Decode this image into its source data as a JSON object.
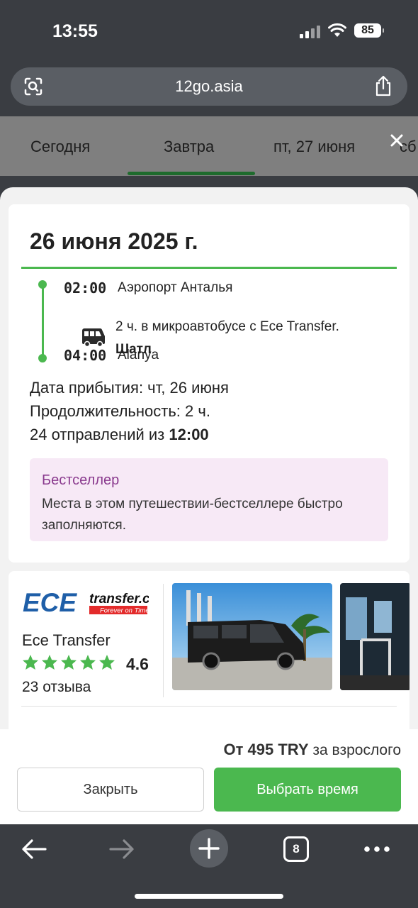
{
  "status_bar": {
    "time": "13:55",
    "battery": "85"
  },
  "browser": {
    "url": "12go.asia",
    "tab_count": "8"
  },
  "date_tabs": [
    {
      "label": "Сегодня"
    },
    {
      "label": "Завтра"
    },
    {
      "label": "пт, 27 июня"
    },
    {
      "label": "сб"
    }
  ],
  "trip": {
    "date_title": "26 июня 2025 г.",
    "departure": {
      "time": "02:00",
      "place": "Аэропорт Анталья"
    },
    "segment": {
      "description": "2 ч. в микроавтобусе с Ece Transfer.",
      "type": "Шатл"
    },
    "arrival": {
      "time": "04:00",
      "place": "Alanya"
    },
    "arrival_date": "Дата прибытия: чт, 26 июня",
    "duration": "Продолжительность: 2 ч.",
    "departures_prefix": "24 отправлений из ",
    "departures_time": "12:00",
    "bestseller_title": "Бестселлер",
    "bestseller_text": "Места в этом путешествии-бестселлере быстро заполняются."
  },
  "operator": {
    "logo_text": "ECE",
    "logo_sub": "transfer.com",
    "logo_tagline": "Forever on Time",
    "name": "Ece Transfer",
    "rating": "4.6",
    "stars": 5,
    "reviews": "23 отзыва"
  },
  "booking": {
    "price_prefix": "От ",
    "price": "495 TRY",
    "price_suffix": " за взрослого",
    "close_label": "Закрыть",
    "select_label": "Выбрать время"
  },
  "colors": {
    "accent_green": "#4bb84f",
    "bestseller_bg": "#f7e9f6",
    "bestseller_title": "#8a3a8e"
  }
}
